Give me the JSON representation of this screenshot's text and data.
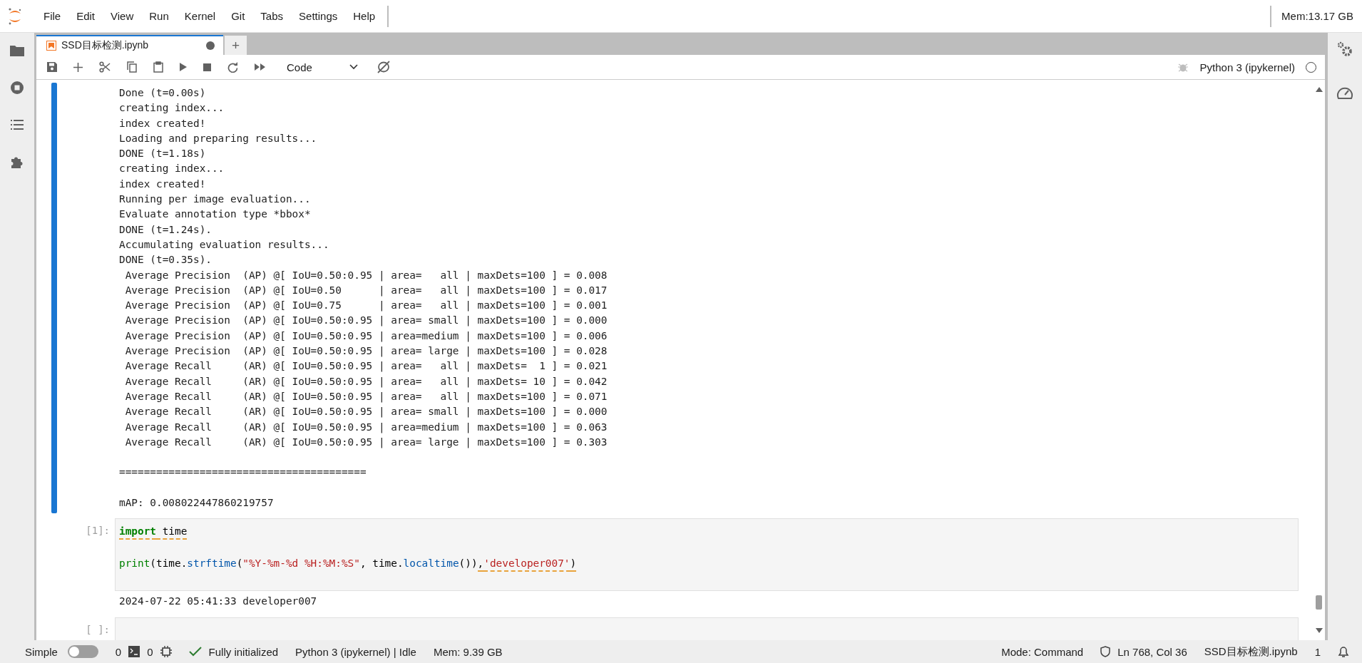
{
  "menu": {
    "items": [
      "File",
      "Edit",
      "View",
      "Run",
      "Kernel",
      "Git",
      "Tabs",
      "Settings",
      "Help"
    ],
    "memory": "Mem:13.17 GB"
  },
  "tabs": [
    {
      "label": "SSD目标检测.ipynb",
      "selected": true,
      "modified": true
    }
  ],
  "new_tab": "+",
  "toolbar": {
    "cell_type": "Code",
    "kernel": "Python 3 (ipykernel)",
    "kernel_busy": false
  },
  "cells": [
    {
      "selected": true,
      "output": [
        {
          "text": "Done (t=0.00s)"
        },
        {
          "text": "creating index..."
        },
        {
          "text": "index created!"
        },
        {
          "text": "Loading and preparing results..."
        },
        {
          "text": "DONE (t=1.18s)"
        },
        {
          "text": "creating index..."
        },
        {
          "text": "index created!"
        },
        {
          "text": "Running per image evaluation..."
        },
        {
          "text": "Evaluate annotation type *bbox*"
        },
        {
          "text": "DONE (t=1.24s)."
        },
        {
          "text": "Accumulating evaluation results..."
        },
        {
          "text": "DONE (t=0.35s)."
        },
        {
          "text": " Average Precision  (AP) @[ IoU=0.50:0.95 | area=   all | maxDets=100 ] = 0.008"
        },
        {
          "text": " Average Precision  (AP) @[ IoU=0.50      | area=   all | maxDets=100 ] = 0.017"
        },
        {
          "text": " Average Precision  (AP) @[ IoU=0.75      | area=   all | maxDets=100 ] = 0.001"
        },
        {
          "text": " Average Precision  (AP) @[ IoU=0.50:0.95 | area= small | maxDets=100 ] = 0.000"
        },
        {
          "text": " Average Precision  (AP) @[ IoU=0.50:0.95 | area=medium | maxDets=100 ] = 0.006"
        },
        {
          "text": " Average Precision  (AP) @[ IoU=0.50:0.95 | area= large | maxDets=100 ] = 0.028"
        },
        {
          "text": " Average Recall     (AR) @[ IoU=0.50:0.95 | area=   all | maxDets=  1 ] = 0.021"
        },
        {
          "text": " Average Recall     (AR) @[ IoU=0.50:0.95 | area=   all | maxDets= 10 ] = 0.042"
        },
        {
          "text": " Average Recall     (AR) @[ IoU=0.50:0.95 | area=   all | maxDets=100 ] = 0.071"
        },
        {
          "text": " Average Recall     (AR) @[ IoU=0.50:0.95 | area= small | maxDets=100 ] = 0.000"
        },
        {
          "text": " Average Recall     (AR) @[ IoU=0.50:0.95 | area=medium | maxDets=100 ] = 0.063"
        },
        {
          "text": " Average Recall     (AR) @[ IoU=0.50:0.95 | area= large | maxDets=100 ] = 0.303"
        },
        {
          "text": "========================================",
          "gap_before": true
        },
        {
          "text": "mAP: 0.008022447860219757",
          "gap_before": true
        }
      ]
    },
    {
      "selected": false,
      "prompt": "[1]:",
      "code": [
        {
          "tokens": [
            {
              "text": "import",
              "kind": "keyword",
              "squiggle": true
            },
            {
              "text": " time",
              "kind": "plain",
              "squiggle": true
            }
          ]
        },
        {
          "blank_before": true,
          "tokens": [
            {
              "text": "print",
              "kind": "builtin",
              "squiggle": false
            },
            {
              "text": "(time.",
              "kind": "plain",
              "squiggle": false
            },
            {
              "text": "strftime",
              "kind": "attr",
              "squiggle": false
            },
            {
              "text": "(",
              "kind": "plain",
              "squiggle": false
            },
            {
              "text": "\"%Y-%m-%d %H:%M:%S\"",
              "kind": "string",
              "squiggle": false
            },
            {
              "text": ", time.",
              "kind": "plain",
              "squiggle": false
            },
            {
              "text": "localtime",
              "kind": "attr",
              "squiggle": false
            },
            {
              "text": "())",
              "kind": "plain",
              "squiggle": false
            },
            {
              "text": ",",
              "kind": "plain",
              "squiggle": true
            },
            {
              "text": "'developer007'",
              "kind": "string",
              "squiggle": true
            },
            {
              "text": ")",
              "kind": "plain",
              "squiggle": true
            }
          ]
        }
      ],
      "output": [
        {
          "text": "2024-07-22 05:41:33 developer007"
        }
      ]
    },
    {
      "selected": false,
      "prompt": "[ ]:"
    }
  ],
  "status_bar": {
    "simple_label": "Simple",
    "simple_on": false,
    "terminals": "0",
    "kernels": "0",
    "extension_status": "Fully initialized",
    "kernel_status": "Python 3 (ipykernel) | Idle",
    "memory": "Mem: 9.39 GB",
    "mode": "Mode: Command",
    "cursor": "Ln 768, Col 36",
    "file": "SSD目标检测.ipynb",
    "notifications": "1"
  }
}
